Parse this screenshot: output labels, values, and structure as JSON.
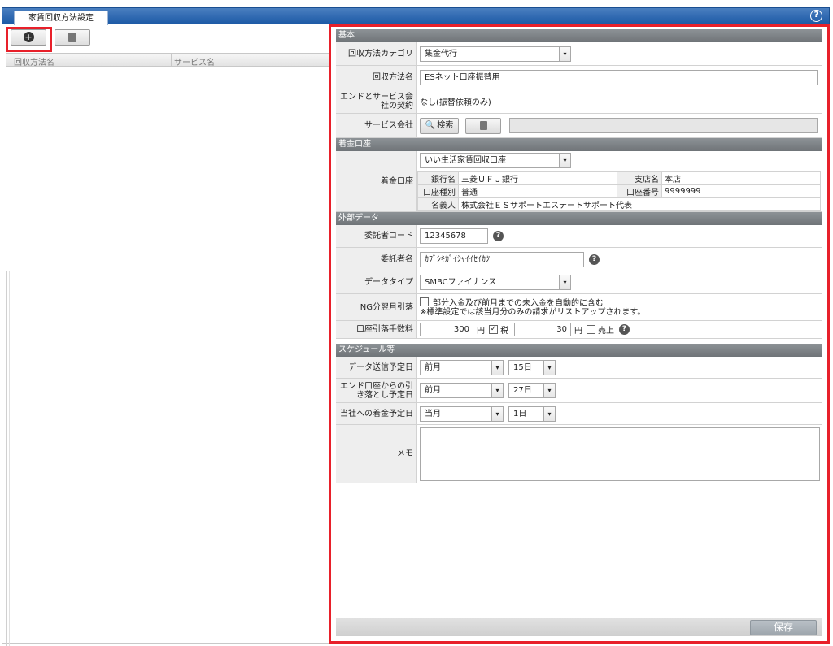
{
  "window": {
    "tab_title": "家賃回収方法設定",
    "help_symbol": "?"
  },
  "toolbar": {
    "add_symbol": "+",
    "delete_symbol": "🗑"
  },
  "list": {
    "columns": [
      "回収方法名",
      "サービス名"
    ]
  },
  "sections": {
    "basic": "基本",
    "deposit": "着金口座",
    "external": "外部データ",
    "schedule": "スケジュール等"
  },
  "basic": {
    "category_label": "回収方法カテゴリ",
    "category_value": "集金代行",
    "name_label": "回収方法名",
    "name_value": "ESネット口座振替用",
    "contract_label": "エンドとサービス会社の契約",
    "contract_value": "なし(振替依頼のみ)",
    "service_label": "サービス会社",
    "search_button": "検索",
    "service_value": ""
  },
  "deposit": {
    "label": "着金口座",
    "account_select": "いい生活家賃回収口座",
    "bank_label": "銀行名",
    "bank_value": "三菱ＵＦＪ銀行",
    "branch_label": "支店名",
    "branch_value": "本店",
    "type_label": "口座種別",
    "type_value": "普通",
    "number_label": "口座番号",
    "number_value": "9999999",
    "holder_label": "名義人",
    "holder_value": "株式会社ＥＳサポートエステートサポート代表"
  },
  "external": {
    "consignor_code_label": "委託者コード",
    "consignor_code_value": "12345678",
    "consignor_name_label": "委託者名",
    "consignor_name_value": "ｶﾌﾞｼｷｶﾞｲｼｬｲｲｾｲｶﾂ",
    "datatype_label": "データタイプ",
    "datatype_value": "SMBCファイナンス",
    "ng_label": "NG分翌月引落",
    "ng_checkbox_text": "部分入金及び前月までの未入金を自動的に含む",
    "ng_note": "※標準設定では該当月分のみの請求がリストアップされます。",
    "fee_label": "口座引落手数料",
    "fee_value": "300",
    "fee_unit": "円",
    "tax_label": "税",
    "tax_value": "30",
    "tax_unit": "円",
    "sales_label": "売上"
  },
  "schedule": {
    "send_label": "データ送信予定日",
    "send_month": "前月",
    "send_day": "15日",
    "debit_label": "エンド口座からの引き落とし予定日",
    "debit_month": "前月",
    "debit_day": "27日",
    "arrival_label": "当社への着金予定日",
    "arrival_month": "当月",
    "arrival_day": "1日",
    "memo_label": "メモ",
    "memo_value": ""
  },
  "footer": {
    "save_label": "保存"
  },
  "colors": {
    "highlight_red": "#e8202a",
    "titlebar_blue": "#1d5aa6",
    "section_gray": "#7a7f83"
  }
}
